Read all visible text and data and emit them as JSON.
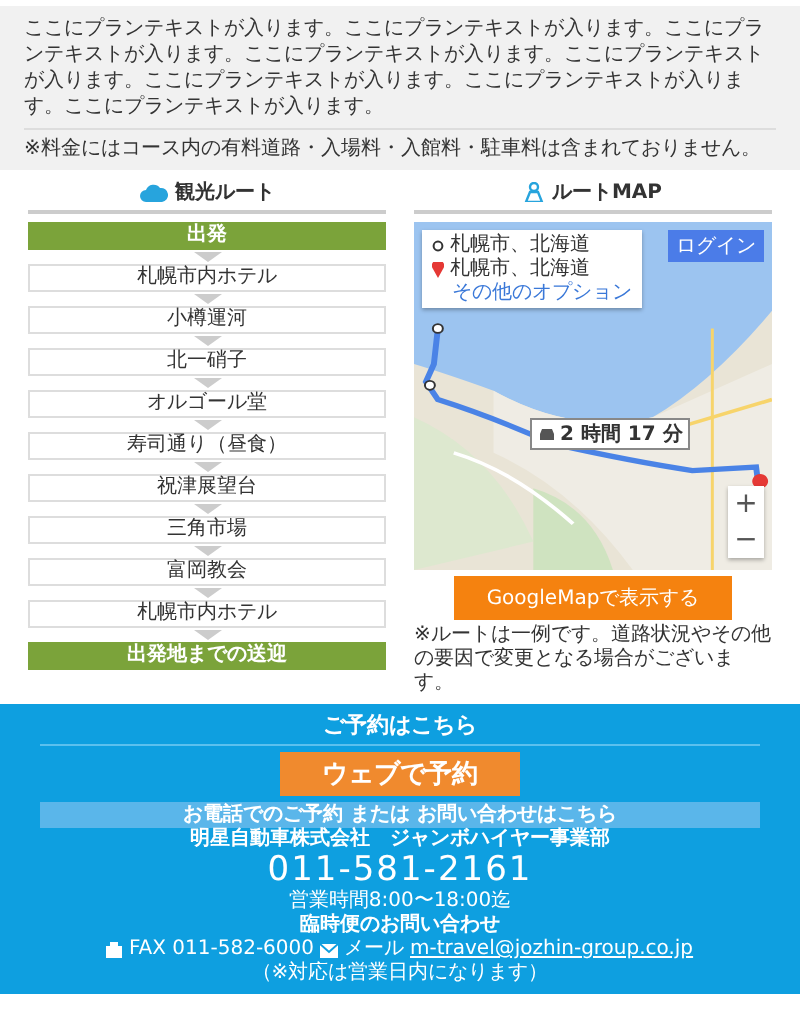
{
  "intro": {
    "paragraph": "ここにプランテキストが入ります。ここにプランテキストが入ります。ここにプランテキストが入ります。ここにプランテキストが入ります。ここにプランテキストが入ります。ここにプランテキストが入ります。ここにプランテキストが入ります。ここにプランテキストが入ります。",
    "note": "※料金にはコース内の有料道路・入場料・入館料・駐車料は含まれておりません。"
  },
  "route": {
    "title": "観光ルート",
    "stops": [
      {
        "label": "出発",
        "kind": "endpoint"
      },
      {
        "label": "札幌市内ホテル",
        "kind": "stop"
      },
      {
        "label": "小樽運河",
        "kind": "stop"
      },
      {
        "label": "北一硝子",
        "kind": "stop"
      },
      {
        "label": "オルゴール堂",
        "kind": "stop"
      },
      {
        "label": "寿司通り（昼食）",
        "kind": "stop"
      },
      {
        "label": "祝津展望台",
        "kind": "stop"
      },
      {
        "label": "三角市場",
        "kind": "stop"
      },
      {
        "label": "富岡教会",
        "kind": "stop"
      },
      {
        "label": "札幌市内ホテル",
        "kind": "stop"
      },
      {
        "label": "出発地までの送迎",
        "kind": "endpoint"
      }
    ]
  },
  "map": {
    "title": "ルートMAP",
    "origin": "札幌市、北海道",
    "destination": "札幌市、北海道",
    "options_link": "その他のオプション",
    "login": "ログイン",
    "duration": "2 時間 17 分",
    "zoom_in": "+",
    "zoom_out": "−",
    "button": "GoogleMapで表示する",
    "note": "※ルートは一例です。道路状況やその他の要因で変更となる場合がございます。"
  },
  "booking": {
    "title": "ご予約はこちら",
    "web_button": "ウェブで予約",
    "phone_bar": "お電話でのご予約 または お問い合わせはこちら",
    "company": "明星自動車株式会社　ジャンボハイヤー事業部",
    "phone": "011-581-2161",
    "hours": "営業時間8:00〜18:00迄",
    "extra_title": "臨時便のお問い合わせ",
    "fax": "FAX 011-582-6000",
    "mail_label": "メール",
    "email": "m-travel@jozhin-group.co.jp",
    "extra_note": "（※対応は営業日内になります）"
  }
}
